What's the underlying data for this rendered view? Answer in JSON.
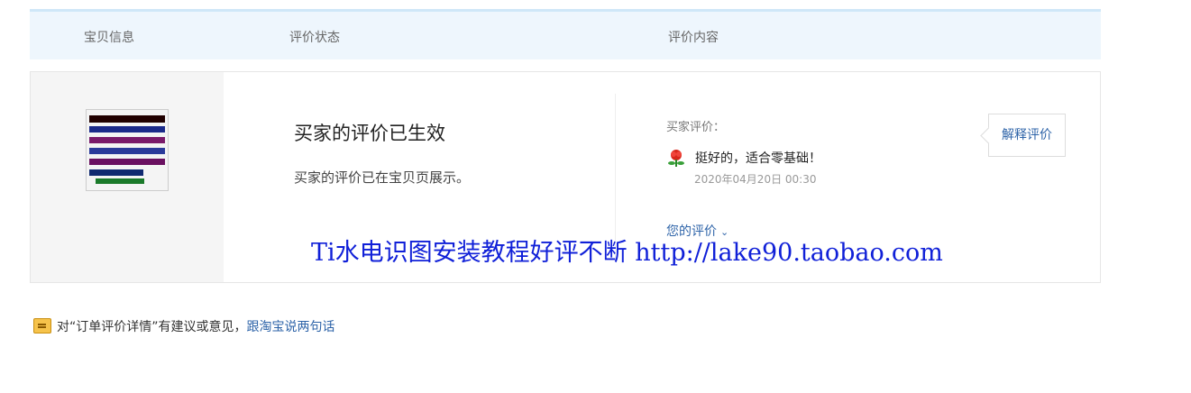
{
  "header": {
    "col_item": "宝贝信息",
    "col_status": "评价状态",
    "col_content": "评价内容"
  },
  "item": {
    "thumb_lines": [
      "Ti水电识图安装",
      "水电材料规格",
      "管路·电线·开关",
      "平面图·系统图·大样",
      "工程预算套价表格",
      "超值资料·免费更新"
    ]
  },
  "status": {
    "title": "买家的评价已生效",
    "desc": "买家的评价已在宝贝页展示。"
  },
  "review": {
    "buyer_label": "买家评价：",
    "comment": "挺好的，适合零基础！",
    "date": "2020年04月20日 00:30",
    "explain_button": "解释评价",
    "your_review": "您的评价"
  },
  "overlay_text": "Ti水电识图安装教程好评不断 http://lake90.taobao.com",
  "feedback": {
    "text": "对“订单评价详情”有建议或意见，",
    "link": "跟淘宝说两句话"
  },
  "icons": [
    "rose-icon",
    "chevron-down-icon",
    "feedback-icon"
  ],
  "colors": {
    "link": "#2d63a8",
    "overlay": "#1020d8",
    "header_bg": "#eef6fd"
  }
}
